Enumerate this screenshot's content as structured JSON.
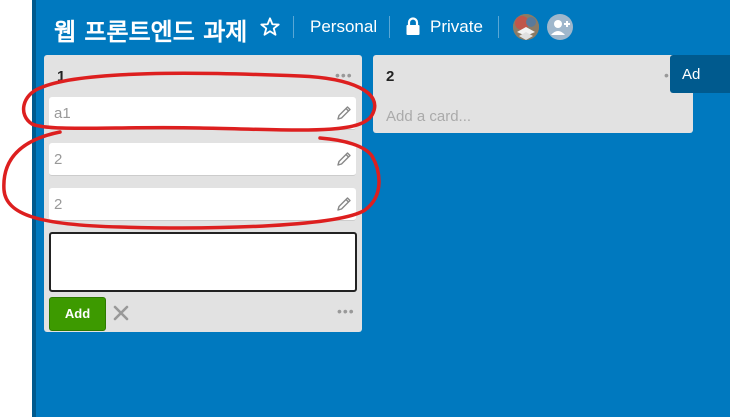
{
  "board": {
    "title": "웹 프론트엔드 과제",
    "visibility_team": "Personal",
    "visibility_privacy": "Private",
    "background_color": "#0079bf"
  },
  "icons": {
    "star": "star-icon",
    "lock": "lock-icon",
    "pencil": "pencil-icon",
    "close": "close-icon",
    "add_member": "add-member-icon",
    "list_menu": "ellipsis-icon"
  },
  "lists": [
    {
      "title": "1",
      "menu_label": "•••",
      "cards": [
        {
          "text": "a1"
        },
        {
          "text": "2"
        },
        {
          "text": "2"
        }
      ],
      "composer": {
        "value": "",
        "add_label": "Add",
        "menu_label": "•••"
      }
    },
    {
      "title": "2",
      "menu_label": "•••",
      "add_card_label": "Add a card..."
    }
  ],
  "add_list": {
    "label": "Ad"
  },
  "annotation": {
    "color": "#dd1f1f"
  }
}
